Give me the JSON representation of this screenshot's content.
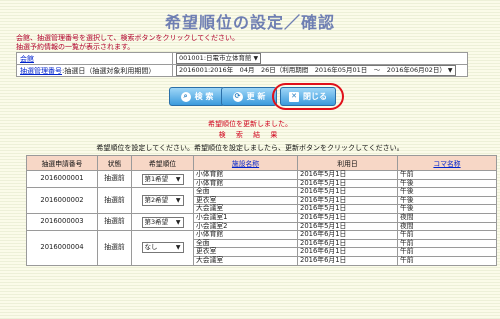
{
  "page": {
    "title": "希望順位の設定／確認"
  },
  "instructions": [
    "会館、抽選管理番号を選択して、検索ボタンをクリックしてください。",
    "抽選予約情報の一覧が表示されます。"
  ],
  "filters": {
    "hall_label": "会館",
    "hall_value": "001001:日電市立体育館",
    "lottery_label": "抽選管理番号",
    "lottery_label_suffix": ":抽選日（抽選対象利用期間）",
    "lottery_value": "2016001:2016年　04月　26日（利用期間　2016年05月01日　～　2016年06月02日）"
  },
  "buttons": {
    "search": "検 索",
    "update": "更 新",
    "close": "閉じる"
  },
  "messages": {
    "updated": "希望順位を更新しました。",
    "result_heading": "検 索 結 果",
    "hint": "希望順位を設定してください。希望順位を設定しましたら、更新ボタンをクリックしてください。"
  },
  "table": {
    "headers": {
      "no": "抽選申請番号",
      "status": "状態",
      "priority": "希望順位",
      "facility": "施設名称",
      "date": "利用日",
      "slot": "コマ名称"
    },
    "groups": [
      {
        "no": "2016000001",
        "status": "抽選前",
        "priority": "第1希望",
        "rows": [
          {
            "facility": "小体育館",
            "date": "2016年5月1日",
            "slot": "午前"
          },
          {
            "facility": "小体育館",
            "date": "2016年5月1日",
            "slot": "午後"
          }
        ]
      },
      {
        "no": "2016000002",
        "status": "抽選前",
        "priority": "第2希望",
        "rows": [
          {
            "facility": "全面",
            "date": "2016年5月1日",
            "slot": "午後"
          },
          {
            "facility": "更衣室",
            "date": "2016年5月1日",
            "slot": "午後"
          },
          {
            "facility": "大会議室",
            "date": "2016年5月1日",
            "slot": "午後"
          }
        ]
      },
      {
        "no": "2016000003",
        "status": "抽選前",
        "priority": "第3希望",
        "rows": [
          {
            "facility": "小会議室1",
            "date": "2016年5月1日",
            "slot": "夜間"
          },
          {
            "facility": "小会議室2",
            "date": "2016年5月1日",
            "slot": "夜間"
          }
        ]
      },
      {
        "no": "2016000004",
        "status": "抽選前",
        "priority": "なし",
        "rows": [
          {
            "facility": "小体育館",
            "date": "2016年6月1日",
            "slot": "午前"
          },
          {
            "facility": "全面",
            "date": "2016年6月1日",
            "slot": "午前"
          },
          {
            "facility": "更衣室",
            "date": "2016年6月1日",
            "slot": "午前"
          },
          {
            "facility": "大会議室",
            "date": "2016年6月1日",
            "slot": "午前"
          }
        ]
      }
    ]
  }
}
